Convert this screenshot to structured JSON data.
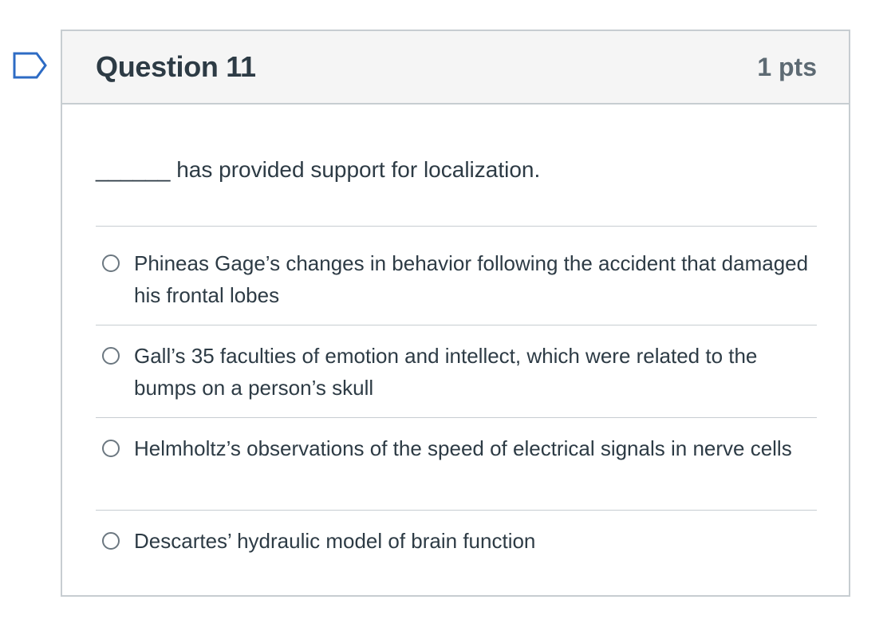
{
  "flag": {
    "icon": "flag-outline-icon"
  },
  "question": {
    "title": "Question 11",
    "points": "1 pts",
    "text": "______ has provided support for localization.",
    "answers": [
      {
        "label": "Phineas Gage’s changes in behavior following the accident that damaged his frontal lobes",
        "selected": false
      },
      {
        "label": "Gall’s 35 faculties of emotion and intellect, which were related to the bumps on a person’s skull",
        "selected": false
      },
      {
        "label": "Helmholtz’s observations of the speed of electrical signals in nerve cells",
        "selected": false
      },
      {
        "label": "Descartes’ hydraulic model of brain function",
        "selected": false
      }
    ]
  },
  "colors": {
    "border": "#c7cdd1",
    "header_bg": "#f5f5f5",
    "text": "#2d3b45",
    "flag": "#2d6bc4"
  }
}
